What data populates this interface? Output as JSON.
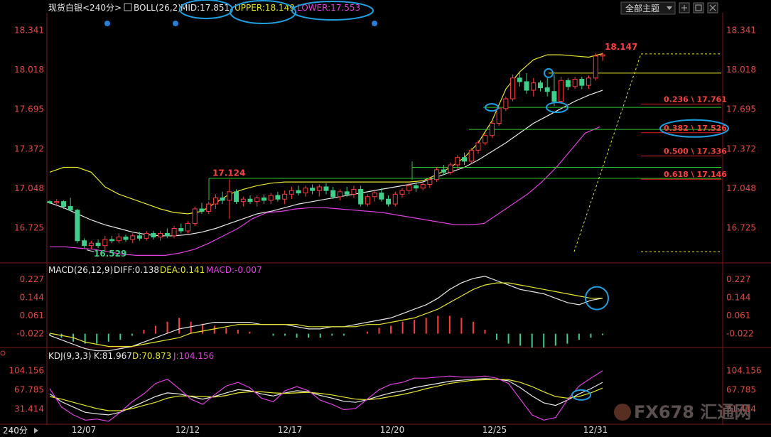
{
  "header": {
    "instrument": "现货白银",
    "period": "<240分>",
    "boll_label": "BOLL(26,2)",
    "mid_label": "MID:17.851",
    "upper_label": "UPPER:18.149",
    "lower_label": "LOWER:17.553",
    "theme_button": "全部主题"
  },
  "chart_data": [
    {
      "type": "candlestick",
      "y_ticks": [
        "18.341",
        "18.018",
        "17.695",
        "17.372",
        "17.048",
        "16.725"
      ],
      "ylim": [
        16.45,
        18.46
      ],
      "x_tick_labels": [
        "12/07",
        "12/12",
        "12/17",
        "12/20",
        "12/25",
        "12/31"
      ],
      "annotations": {
        "high_label": "18.147",
        "low_label": "16.529",
        "swing_label": "17.124"
      },
      "fib_levels": [
        {
          "label": "0.236 \\ 17.761",
          "value": 17.761
        },
        {
          "label": "0.382 \\ 17.526",
          "value": 17.526
        },
        {
          "label": "0.500 \\ 17.336",
          "value": 17.336
        },
        {
          "label": "0.618 \\ 17.146",
          "value": 17.146
        }
      ],
      "horizontal_levels": [
        17.99,
        17.71,
        17.53,
        17.22,
        17.13,
        17.13
      ],
      "candles": [
        [
          16.94,
          16.95,
          16.92,
          16.93
        ],
        [
          16.93,
          16.96,
          16.9,
          16.94
        ],
        [
          16.94,
          16.95,
          16.88,
          16.9
        ],
        [
          16.9,
          16.97,
          16.86,
          16.87
        ],
        [
          16.87,
          16.88,
          16.6,
          16.62
        ],
        [
          16.62,
          16.64,
          16.56,
          16.58
        ],
        [
          16.58,
          16.62,
          16.55,
          16.6
        ],
        [
          16.6,
          16.63,
          16.56,
          16.58
        ],
        [
          16.58,
          16.66,
          16.53,
          16.63
        ],
        [
          16.63,
          16.66,
          16.6,
          16.62
        ],
        [
          16.62,
          16.68,
          16.6,
          16.65
        ],
        [
          16.65,
          16.67,
          16.61,
          16.63
        ],
        [
          16.63,
          16.68,
          16.6,
          16.66
        ],
        [
          16.66,
          16.69,
          16.62,
          16.64
        ],
        [
          16.64,
          16.7,
          16.62,
          16.68
        ],
        [
          16.68,
          16.7,
          16.63,
          16.65
        ],
        [
          16.65,
          16.7,
          16.62,
          16.68
        ],
        [
          16.68,
          16.72,
          16.64,
          16.66
        ],
        [
          16.66,
          16.74,
          16.64,
          16.72
        ],
        [
          16.72,
          16.76,
          16.68,
          16.7
        ],
        [
          16.7,
          16.78,
          16.68,
          16.76
        ],
        [
          16.76,
          16.9,
          16.74,
          16.88
        ],
        [
          16.88,
          16.93,
          16.84,
          16.86
        ],
        [
          16.86,
          16.94,
          16.84,
          16.92
        ],
        [
          16.92,
          17.0,
          16.88,
          16.97
        ],
        [
          16.97,
          17.02,
          16.92,
          16.95
        ],
        [
          16.95,
          17.12,
          16.8,
          17.02
        ],
        [
          17.02,
          17.04,
          16.92,
          16.94
        ],
        [
          16.94,
          16.98,
          16.9,
          16.96
        ],
        [
          16.96,
          16.99,
          16.92,
          16.94
        ],
        [
          16.94,
          16.99,
          16.9,
          16.97
        ],
        [
          16.97,
          17.0,
          16.92,
          16.95
        ],
        [
          16.95,
          17.01,
          16.92,
          16.99
        ],
        [
          16.99,
          17.02,
          16.94,
          16.96
        ],
        [
          16.96,
          17.03,
          16.92,
          17.0
        ],
        [
          17.0,
          17.06,
          16.96,
          17.03
        ],
        [
          17.03,
          17.07,
          16.99,
          17.01
        ],
        [
          17.01,
          17.07,
          16.98,
          17.05
        ],
        [
          17.05,
          17.08,
          17.0,
          17.03
        ],
        [
          17.03,
          17.08,
          16.98,
          17.06
        ],
        [
          17.06,
          17.09,
          17.0,
          17.03
        ],
        [
          17.03,
          17.06,
          16.96,
          16.98
        ],
        [
          16.98,
          17.04,
          16.95,
          17.02
        ],
        [
          17.02,
          17.06,
          16.98,
          17.0
        ],
        [
          17.0,
          17.07,
          16.97,
          17.04
        ],
        [
          17.04,
          17.07,
          16.9,
          16.92
        ],
        [
          16.92,
          17.0,
          16.9,
          16.98
        ],
        [
          16.98,
          17.03,
          16.94,
          17.01
        ],
        [
          17.01,
          17.05,
          16.94,
          16.96
        ],
        [
          16.96,
          16.99,
          16.9,
          16.92
        ],
        [
          16.92,
          17.02,
          16.9,
          17.0
        ],
        [
          17.0,
          17.05,
          16.97,
          17.03
        ],
        [
          17.03,
          17.1,
          17.0,
          17.07
        ],
        [
          17.07,
          17.1,
          17.02,
          17.05
        ],
        [
          17.05,
          17.1,
          17.03,
          17.08
        ],
        [
          17.08,
          17.14,
          17.05,
          17.12
        ],
        [
          17.12,
          17.22,
          17.1,
          17.2
        ],
        [
          17.2,
          17.24,
          17.16,
          17.18
        ],
        [
          17.18,
          17.26,
          17.16,
          17.24
        ],
        [
          17.24,
          17.32,
          17.2,
          17.3
        ],
        [
          17.3,
          17.34,
          17.24,
          17.27
        ],
        [
          17.27,
          17.38,
          17.25,
          17.36
        ],
        [
          17.36,
          17.44,
          17.33,
          17.42
        ],
        [
          17.42,
          17.5,
          17.4,
          17.48
        ],
        [
          17.48,
          17.6,
          17.46,
          17.58
        ],
        [
          17.58,
          17.72,
          17.56,
          17.7
        ],
        [
          17.7,
          17.8,
          17.68,
          17.78
        ],
        [
          17.78,
          17.98,
          17.76,
          17.95
        ],
        [
          17.95,
          18.0,
          17.88,
          17.92
        ],
        [
          17.92,
          17.99,
          17.82,
          17.85
        ],
        [
          17.85,
          17.95,
          17.8,
          17.91
        ],
        [
          17.91,
          17.93,
          17.84,
          17.87
        ],
        [
          17.87,
          17.95,
          17.8,
          17.84
        ],
        [
          17.84,
          17.98,
          17.72,
          17.76
        ],
        [
          17.76,
          17.96,
          17.74,
          17.93
        ],
        [
          17.93,
          17.95,
          17.85,
          17.88
        ],
        [
          17.88,
          17.96,
          17.86,
          17.94
        ],
        [
          17.94,
          17.96,
          17.86,
          17.89
        ],
        [
          17.89,
          17.97,
          17.86,
          17.95
        ],
        [
          17.95,
          18.15,
          17.93,
          18.13
        ],
        [
          18.13,
          18.16,
          18.09,
          18.14
        ]
      ],
      "series": [
        {
          "name": "MID",
          "values": [
            16.93,
            16.89,
            16.84,
            16.79,
            16.75,
            16.72,
            16.69,
            16.67,
            16.66,
            16.66,
            16.67,
            16.69,
            16.72,
            16.76,
            16.8,
            16.84,
            16.86,
            16.89,
            16.92,
            16.94,
            16.96,
            16.98,
            17.0,
            17.02,
            17.04,
            17.06,
            17.08,
            17.1,
            17.14,
            17.18,
            17.22,
            17.28,
            17.35,
            17.42,
            17.5,
            17.58,
            17.64,
            17.7,
            17.76,
            17.81,
            17.85
          ]
        },
        {
          "name": "UPPER",
          "values": [
            17.18,
            17.22,
            17.22,
            17.18,
            17.06,
            17.0,
            16.96,
            16.92,
            16.88,
            16.85,
            16.84,
            16.86,
            16.93,
            17.0,
            17.04,
            17.07,
            17.09,
            17.1,
            17.1,
            17.1,
            17.1,
            17.1,
            17.1,
            17.1,
            17.1,
            17.1,
            17.1,
            17.11,
            17.16,
            17.22,
            17.3,
            17.42,
            17.6,
            17.86,
            18.0,
            18.1,
            18.14,
            18.14,
            18.13,
            18.12,
            18.15
          ]
        },
        {
          "name": "LOWER",
          "values": [
            16.57,
            16.57,
            16.56,
            16.55,
            16.53,
            16.51,
            16.5,
            16.5,
            16.5,
            16.52,
            16.55,
            16.6,
            16.66,
            16.72,
            16.8,
            16.85,
            16.86,
            16.88,
            16.89,
            16.89,
            16.88,
            16.87,
            16.86,
            16.85,
            16.83,
            16.81,
            16.79,
            16.77,
            16.75,
            16.75,
            16.76,
            16.84,
            16.92,
            17.0,
            17.1,
            17.22,
            17.36,
            17.5,
            17.55
          ]
        }
      ]
    },
    {
      "type": "bar",
      "title": "MACD(26,12,9)",
      "legend": {
        "diff": "DIFF:0.138",
        "dea": "DEA:0.141",
        "macd": "MACD:-0.007"
      },
      "y_ticks": [
        "0.227",
        "0.144",
        "0.061",
        "-0.022"
      ],
      "ylim": [
        -0.075,
        0.275
      ],
      "series": [
        {
          "name": "DIFF",
          "values": [
            -0.03,
            -0.05,
            -0.07,
            -0.09,
            -0.1,
            -0.1,
            -0.09,
            -0.08,
            -0.06,
            -0.04,
            -0.02,
            0.0,
            0.01,
            0.02,
            0.03,
            0.03,
            0.03,
            0.03,
            0.02,
            0.02,
            0.02,
            0.01,
            0.0,
            0.0,
            0.01,
            0.01,
            0.02,
            0.03,
            0.04,
            0.05,
            0.07,
            0.09,
            0.11,
            0.14,
            0.18,
            0.21,
            0.23,
            0.24,
            0.22,
            0.2,
            0.18,
            0.17,
            0.16,
            0.14,
            0.12,
            0.11,
            0.13,
            0.14
          ]
        },
        {
          "name": "DEA",
          "values": [
            -0.02,
            -0.03,
            -0.04,
            -0.06,
            -0.07,
            -0.08,
            -0.08,
            -0.08,
            -0.07,
            -0.06,
            -0.05,
            -0.04,
            -0.02,
            -0.01,
            0.0,
            0.01,
            0.02,
            0.02,
            0.02,
            0.02,
            0.02,
            0.02,
            0.01,
            0.01,
            0.01,
            0.01,
            0.01,
            0.02,
            0.02,
            0.03,
            0.04,
            0.05,
            0.07,
            0.09,
            0.12,
            0.15,
            0.18,
            0.2,
            0.21,
            0.21,
            0.2,
            0.19,
            0.18,
            0.17,
            0.16,
            0.15,
            0.14,
            0.14
          ]
        },
        {
          "name": "MACD",
          "values": [
            -0.01,
            -0.02,
            -0.04,
            -0.05,
            -0.05,
            -0.04,
            -0.03,
            -0.01,
            0.02,
            0.04,
            0.06,
            0.08,
            0.06,
            0.05,
            0.04,
            0.03,
            0.02,
            0.01,
            0.0,
            -0.01,
            -0.01,
            -0.02,
            -0.02,
            -0.02,
            -0.01,
            -0.01,
            0.0,
            0.01,
            0.03,
            0.04,
            0.06,
            0.07,
            0.08,
            0.09,
            0.09,
            0.08,
            0.06,
            0.02,
            -0.03,
            -0.05,
            -0.06,
            -0.07,
            -0.07,
            -0.06,
            -0.05,
            -0.03,
            -0.02,
            -0.007
          ]
        }
      ]
    },
    {
      "type": "line",
      "title": "KDJ(9,3,3)",
      "legend": {
        "k": "K:81.967",
        "d": "D:70.873",
        "j": "J:104.156"
      },
      "y_ticks": [
        "104.156",
        "67.785",
        "31.414"
      ],
      "ylim": [
        5,
        120
      ],
      "series": [
        {
          "name": "K",
          "values": [
            60,
            45,
            35,
            25,
            22,
            20,
            25,
            35,
            45,
            55,
            62,
            60,
            55,
            50,
            55,
            62,
            68,
            66,
            60,
            56,
            62,
            66,
            64,
            57,
            52,
            46,
            44,
            49,
            56,
            62,
            66,
            72,
            76,
            80,
            84,
            86,
            88,
            89,
            88,
            85,
            72,
            56,
            43,
            38,
            48,
            60,
            70,
            82
          ]
        },
        {
          "name": "D",
          "values": [
            55,
            50,
            44,
            38,
            32,
            28,
            28,
            32,
            38,
            44,
            52,
            56,
            56,
            55,
            54,
            57,
            62,
            64,
            64,
            62,
            61,
            62,
            63,
            61,
            58,
            54,
            50,
            49,
            51,
            55,
            59,
            64,
            70,
            75,
            80,
            83,
            86,
            87,
            88,
            87,
            82,
            74,
            64,
            55,
            52,
            55,
            62,
            71
          ]
        },
        {
          "name": "J",
          "values": [
            70,
            35,
            20,
            10,
            12,
            8,
            25,
            45,
            60,
            80,
            88,
            70,
            50,
            40,
            58,
            75,
            82,
            72,
            52,
            45,
            66,
            74,
            66,
            48,
            40,
            30,
            32,
            50,
            68,
            78,
            82,
            90,
            90,
            92,
            94,
            92,
            92,
            94,
            90,
            80,
            50,
            20,
            10,
            15,
            48,
            75,
            90,
            104
          ]
        }
      ]
    }
  ],
  "watermark": "FX678 汇通网"
}
